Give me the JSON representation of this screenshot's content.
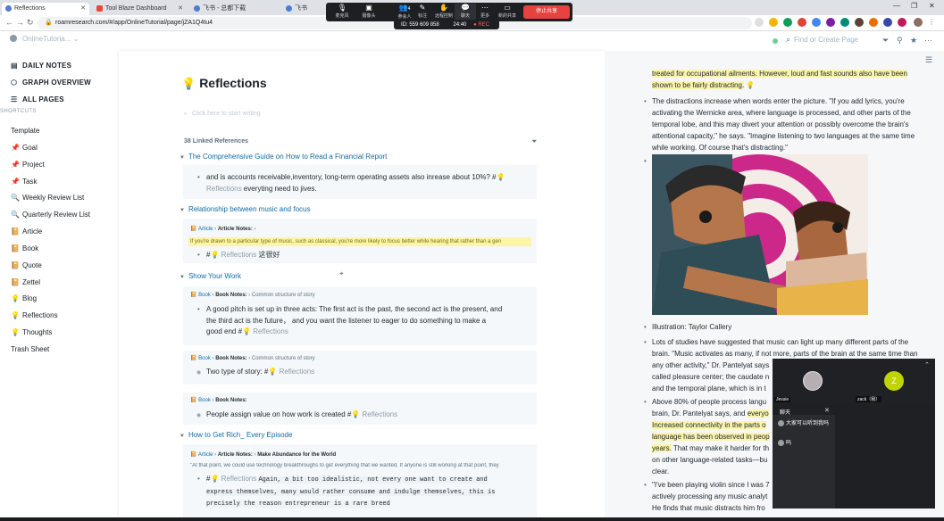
{
  "browser": {
    "tabs": [
      {
        "label": "Reflections",
        "active": true
      },
      {
        "label": "Tool Blaze Dashboard",
        "active": false
      },
      {
        "label": "飞书 - 总都下载",
        "active": false
      },
      {
        "label": "飞书",
        "active": false
      }
    ],
    "url": "roamresearch.com/#/app/OnlineTutorial/page/jZA1Q4tu4"
  },
  "meeting": {
    "buttons": [
      {
        "icon": "mic-icon",
        "glyph": "🎙",
        "label": "麦克风"
      },
      {
        "icon": "camera-icon",
        "glyph": "▣",
        "label": "摄像头"
      },
      {
        "icon": "participants-icon",
        "glyph": "👥",
        "label": "参会人"
      },
      {
        "icon": "annotate-icon",
        "glyph": "✎",
        "label": "标注"
      },
      {
        "icon": "remote-control-icon",
        "glyph": "✋",
        "label": "远程控制"
      },
      {
        "icon": "chat-icon",
        "glyph": "💬",
        "label": "聊天"
      },
      {
        "icon": "more-icon",
        "glyph": "⋯",
        "label": "更多"
      },
      {
        "icon": "new-share-icon",
        "glyph": "▭",
        "label": "新的共享"
      }
    ],
    "participant_count": "4",
    "stop_label": "停止共享",
    "id_text": "ID: 559 609 858",
    "timer": "24:40",
    "rec": "● REC",
    "chat_title": "聊天",
    "video_names": [
      "Jessie",
      "zack（我）"
    ],
    "chat_messages": [
      "大家可以听到我吗",
      "吗"
    ],
    "avatar_letter": "Z"
  },
  "roam": {
    "graph_name": "OnlineTutoria...",
    "search_placeholder": "Find or Create Page"
  },
  "sidebar": {
    "nav": [
      {
        "label": "DAILY NOTES",
        "icon": "calendar-icon"
      },
      {
        "label": "GRAPH OVERVIEW",
        "icon": "graph-icon"
      },
      {
        "label": "ALL PAGES",
        "icon": "list-icon"
      }
    ],
    "shortcuts_label": "SHORTCUTS",
    "shortcuts": [
      {
        "label": "Template",
        "icon": ""
      },
      {
        "label": "Goal",
        "icon": "pin-icon"
      },
      {
        "label": "Project",
        "icon": "pin-icon"
      },
      {
        "label": "Task",
        "icon": "pin-icon"
      },
      {
        "label": "Weekly Review List",
        "icon": "magnifier-icon"
      },
      {
        "label": "Quarterly Review List",
        "icon": "magnifier-icon"
      },
      {
        "label": "Article",
        "icon": "book-icon"
      },
      {
        "label": "Book",
        "icon": "book-icon"
      },
      {
        "label": "Quote",
        "icon": "book-icon"
      },
      {
        "label": "Zettel",
        "icon": "book-icon"
      },
      {
        "label": "Blog",
        "icon": "bulb-icon"
      },
      {
        "label": "Reflections",
        "icon": "bulb-icon"
      },
      {
        "label": "Thoughts",
        "icon": "bulb-icon"
      },
      {
        "label": "Trash Sheet",
        "icon": ""
      }
    ]
  },
  "page": {
    "title": "Reflections",
    "placeholder": "Click here to start writing",
    "linked_count": "38 Linked References",
    "refs": [
      {
        "heading": "The Comprehensive Guide on How to Read a Financial Report",
        "block_text": "and is accounts receivable,inventory, long-term operating assets also inrease about 10%? #",
        "tag": "Reflections",
        "block_tail": " everyting need to jives."
      },
      {
        "heading": "Relationship between music and focus",
        "crumb": [
          "Article",
          "Article Notes:"
        ],
        "highlight": "If you're drawn to a particular type of music, such as classical, you're more likely to focus better while hearing that rather than a gen",
        "block_text": "#",
        "tag": "Reflections",
        "block_tail": " 这很好"
      },
      {
        "heading": "Show Your Work",
        "crumb": [
          "Book",
          "Book Notes:",
          "Common structure of story"
        ],
        "block_lines": [
          "A good pitch is set up in three acts: The first act is the past, the second act is the present, and",
          "the third act is the future，  and you want the listener to eager to do something to make a",
          "good end  #"
        ],
        "tag": "Reflections",
        "crumb2": [
          "Book",
          "Book Notes:",
          "Common structure of story"
        ],
        "block2_text": "Two type of story:  #",
        "crumb3": [
          "Book",
          "Book Notes:"
        ],
        "block3_text": "People assign value on  how work is created #"
      },
      {
        "heading": "How to Get Rich_ Every Episode",
        "crumb": [
          "Article",
          "Article Notes:",
          "Make Abundance for the World"
        ],
        "quote": "\"At that point, we could use technology breakthroughs to get everything that we wanted. If anyone is still working at that point, they",
        "tag": "Reflections",
        "code_lines": [
          "Again, a bit too idealistic, not every one want to create and",
          "express themselves, many would rather consume and indulge themselves, this is",
          "precisely the reason entrepreneur is a rare breed"
        ]
      }
    ]
  },
  "right_panel": {
    "top_highlight_1": "treated for occupational ailments. However, loud and fast sounds also have been",
    "top_highlight_2": "shown to be fairly distracting.",
    "para1": [
      "The distractions increase when words enter the picture. \"If you add lyrics, you're",
      "activating the Wernicke area, where language is processed, and other parts of the",
      "temporal lobe, and this may divert your attention or possibly overcome the brain's",
      "attentional capacity,\" he says. \"Imagine listening to two languages at the same time",
      "while working. Of course that's distracting.\""
    ],
    "illustration_caption": "Illustration: Taylor Callery",
    "para2": [
      "Lots of studies have suggested that music can light up many different parts of the",
      "brain. \"Music activates as many, if not more, parts of the brain at the same time than",
      "any other activity,\" Dr. Pantelyat says",
      "called pleasure center; the caudate n",
      "and the temporal plane, which is in t"
    ],
    "para3_a": "Above 80% of people process langu",
    "para3_b": "brain, Dr. Pantelyat says, and ",
    "para3_b_hl": "everyo",
    "para3_c_hl": "Increased connectivity in the parts o",
    "para3_d_hl": "language has been observed in peop",
    "para3_e_hl": "years.",
    "para3_e": " That may make it harder for th",
    "para3_f": "on other language-related tasks—bu",
    "para3_g": "clear.",
    "para4_a": "\"I've been playing violin since I was 7",
    "para4_b": "actively processing any music analyt",
    "para4_c": "He finds that music distracts him fro"
  }
}
